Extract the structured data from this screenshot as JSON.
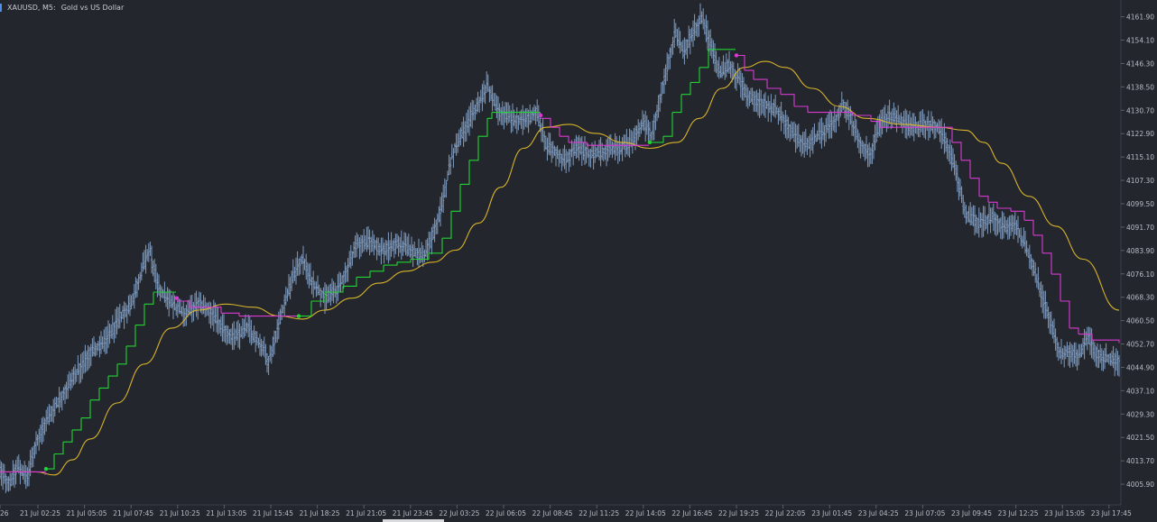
{
  "title": {
    "symbol": "XAUUSD, M5:",
    "description": "Gold vs US Dollar"
  },
  "colors": {
    "background": "#23262d",
    "candles": "#7f9cc0",
    "trend_up": "#22d334",
    "trend_down": "#d93ad2",
    "moving_average": "#d8b32a",
    "axis_text": "#b8bcc4"
  },
  "chart_data": {
    "type": "line",
    "style": "OHLC bars with step trailing line (green up / magenta down) and smooth moving average",
    "grid": false,
    "y_ticks": [
      "4161.90",
      "4154.10",
      "4146.30",
      "4138.50",
      "4130.70",
      "4122.90",
      "4115.10",
      "4107.30",
      "4099.50",
      "4091.70",
      "4083.90",
      "4076.10",
      "4068.30",
      "4060.50",
      "4052.70",
      "4044.90",
      "4037.10",
      "4029.30",
      "4021.50",
      "4013.70",
      "4005.90"
    ],
    "ylim": [
      3999.0,
      4167.5
    ],
    "x_ticks": [
      "26",
      "21 Jul 02:25",
      "21 Jul 05:05",
      "21 Jul 07:45",
      "21 Jul 10:25",
      "21 Jul 13:05",
      "21 Jul 15:45",
      "21 Jul 18:25",
      "21 Jul 21:05",
      "21 Jul 23:45",
      "22 Jul 03:25",
      "22 Jul 06:05",
      "22 Jul 08:45",
      "22 Jul 11:25",
      "22 Jul 14:05",
      "22 Jul 16:45",
      "22 Jul 19:25",
      "22 Jul 22:05",
      "23 Jul 01:45",
      "23 Jul 04:25",
      "23 Jul 07:05",
      "23 Jul 09:45",
      "23 Jul 12:25",
      "23 Jul 15:05",
      "23 Jul 17:45"
    ],
    "price_series": [
      {
        "bar": 0,
        "price": 4010
      },
      {
        "bar": 10,
        "price": 4006
      },
      {
        "bar": 20,
        "price": 4012
      },
      {
        "bar": 30,
        "price": 4008
      },
      {
        "bar": 40,
        "price": 4020
      },
      {
        "bar": 55,
        "price": 4029
      },
      {
        "bar": 70,
        "price": 4036
      },
      {
        "bar": 85,
        "price": 4043
      },
      {
        "bar": 100,
        "price": 4050
      },
      {
        "bar": 115,
        "price": 4053
      },
      {
        "bar": 130,
        "price": 4060
      },
      {
        "bar": 145,
        "price": 4066
      },
      {
        "bar": 158,
        "price": 4078
      },
      {
        "bar": 166,
        "price": 4084
      },
      {
        "bar": 175,
        "price": 4071
      },
      {
        "bar": 190,
        "price": 4066
      },
      {
        "bar": 205,
        "price": 4063
      },
      {
        "bar": 220,
        "price": 4066
      },
      {
        "bar": 235,
        "price": 4063
      },
      {
        "bar": 245,
        "price": 4058
      },
      {
        "bar": 260,
        "price": 4055
      },
      {
        "bar": 275,
        "price": 4058
      },
      {
        "bar": 290,
        "price": 4052
      },
      {
        "bar": 298,
        "price": 4047
      },
      {
        "bar": 305,
        "price": 4055
      },
      {
        "bar": 315,
        "price": 4066
      },
      {
        "bar": 325,
        "price": 4076
      },
      {
        "bar": 335,
        "price": 4081
      },
      {
        "bar": 345,
        "price": 4074
      },
      {
        "bar": 360,
        "price": 4068
      },
      {
        "bar": 375,
        "price": 4071
      },
      {
        "bar": 385,
        "price": 4078
      },
      {
        "bar": 395,
        "price": 4086
      },
      {
        "bar": 410,
        "price": 4087
      },
      {
        "bar": 425,
        "price": 4084
      },
      {
        "bar": 440,
        "price": 4086
      },
      {
        "bar": 455,
        "price": 4084
      },
      {
        "bar": 470,
        "price": 4082
      },
      {
        "bar": 480,
        "price": 4089
      },
      {
        "bar": 490,
        "price": 4099
      },
      {
        "bar": 500,
        "price": 4115
      },
      {
        "bar": 510,
        "price": 4122
      },
      {
        "bar": 520,
        "price": 4127
      },
      {
        "bar": 530,
        "price": 4133
      },
      {
        "bar": 540,
        "price": 4139
      },
      {
        "bar": 550,
        "price": 4131
      },
      {
        "bar": 565,
        "price": 4128
      },
      {
        "bar": 580,
        "price": 4127
      },
      {
        "bar": 595,
        "price": 4130
      },
      {
        "bar": 605,
        "price": 4119
      },
      {
        "bar": 615,
        "price": 4117
      },
      {
        "bar": 625,
        "price": 4114
      },
      {
        "bar": 640,
        "price": 4118
      },
      {
        "bar": 655,
        "price": 4116
      },
      {
        "bar": 670,
        "price": 4117
      },
      {
        "bar": 685,
        "price": 4118
      },
      {
        "bar": 700,
        "price": 4120
      },
      {
        "bar": 712,
        "price": 4127
      },
      {
        "bar": 722,
        "price": 4122
      },
      {
        "bar": 730,
        "price": 4133
      },
      {
        "bar": 740,
        "price": 4146
      },
      {
        "bar": 748,
        "price": 4157
      },
      {
        "bar": 758,
        "price": 4150
      },
      {
        "bar": 768,
        "price": 4157
      },
      {
        "bar": 778,
        "price": 4162
      },
      {
        "bar": 788,
        "price": 4152
      },
      {
        "bar": 798,
        "price": 4143
      },
      {
        "bar": 808,
        "price": 4146
      },
      {
        "bar": 818,
        "price": 4141
      },
      {
        "bar": 830,
        "price": 4135
      },
      {
        "bar": 845,
        "price": 4133
      },
      {
        "bar": 860,
        "price": 4131
      },
      {
        "bar": 870,
        "price": 4127
      },
      {
        "bar": 880,
        "price": 4122
      },
      {
        "bar": 895,
        "price": 4119
      },
      {
        "bar": 910,
        "price": 4123
      },
      {
        "bar": 925,
        "price": 4127
      },
      {
        "bar": 935,
        "price": 4133
      },
      {
        "bar": 945,
        "price": 4126
      },
      {
        "bar": 955,
        "price": 4119
      },
      {
        "bar": 965,
        "price": 4116
      },
      {
        "bar": 975,
        "price": 4126
      },
      {
        "bar": 985,
        "price": 4129
      },
      {
        "bar": 1000,
        "price": 4127
      },
      {
        "bar": 1010,
        "price": 4125
      },
      {
        "bar": 1025,
        "price": 4126
      },
      {
        "bar": 1040,
        "price": 4125
      },
      {
        "bar": 1050,
        "price": 4119
      },
      {
        "bar": 1060,
        "price": 4109
      },
      {
        "bar": 1070,
        "price": 4096
      },
      {
        "bar": 1085,
        "price": 4093
      },
      {
        "bar": 1100,
        "price": 4095
      },
      {
        "bar": 1115,
        "price": 4091
      },
      {
        "bar": 1125,
        "price": 4093
      },
      {
        "bar": 1135,
        "price": 4086
      },
      {
        "bar": 1145,
        "price": 4079
      },
      {
        "bar": 1155,
        "price": 4068
      },
      {
        "bar": 1165,
        "price": 4060
      },
      {
        "bar": 1175,
        "price": 4049
      },
      {
        "bar": 1185,
        "price": 4050
      },
      {
        "bar": 1195,
        "price": 4048
      },
      {
        "bar": 1205,
        "price": 4055
      },
      {
        "bar": 1215,
        "price": 4050
      },
      {
        "bar": 1225,
        "price": 4048
      },
      {
        "bar": 1240,
        "price": 4047
      }
    ],
    "trend_line": [
      {
        "bar": 0,
        "price": 4010,
        "dir": "down"
      },
      {
        "bar": 50,
        "price": 4009,
        "dir": "down"
      },
      {
        "bar": 51,
        "price": 4011,
        "dir": "up"
      },
      {
        "bar": 60,
        "price": 4016,
        "dir": "up"
      },
      {
        "bar": 70,
        "price": 4020,
        "dir": "up"
      },
      {
        "bar": 80,
        "price": 4024,
        "dir": "up"
      },
      {
        "bar": 90,
        "price": 4028,
        "dir": "up"
      },
      {
        "bar": 100,
        "price": 4034,
        "dir": "up"
      },
      {
        "bar": 110,
        "price": 4038,
        "dir": "up"
      },
      {
        "bar": 120,
        "price": 4042,
        "dir": "up"
      },
      {
        "bar": 130,
        "price": 4046,
        "dir": "up"
      },
      {
        "bar": 140,
        "price": 4052,
        "dir": "up"
      },
      {
        "bar": 150,
        "price": 4059,
        "dir": "up"
      },
      {
        "bar": 160,
        "price": 4066,
        "dir": "up"
      },
      {
        "bar": 170,
        "price": 4070,
        "dir": "up"
      },
      {
        "bar": 195,
        "price": 4070,
        "dir": "up"
      },
      {
        "bar": 196,
        "price": 4067,
        "dir": "down"
      },
      {
        "bar": 210,
        "price": 4065,
        "dir": "down"
      },
      {
        "bar": 235,
        "price": 4065,
        "dir": "down"
      },
      {
        "bar": 245,
        "price": 4063,
        "dir": "down"
      },
      {
        "bar": 265,
        "price": 4062,
        "dir": "down"
      },
      {
        "bar": 330,
        "price": 4062,
        "dir": "down"
      },
      {
        "bar": 331,
        "price": 4062,
        "dir": "up"
      },
      {
        "bar": 345,
        "price": 4067,
        "dir": "up"
      },
      {
        "bar": 360,
        "price": 4070,
        "dir": "up"
      },
      {
        "bar": 380,
        "price": 4072,
        "dir": "up"
      },
      {
        "bar": 395,
        "price": 4075,
        "dir": "up"
      },
      {
        "bar": 410,
        "price": 4077,
        "dir": "up"
      },
      {
        "bar": 425,
        "price": 4079,
        "dir": "up"
      },
      {
        "bar": 440,
        "price": 4080,
        "dir": "up"
      },
      {
        "bar": 455,
        "price": 4081,
        "dir": "up"
      },
      {
        "bar": 475,
        "price": 4083,
        "dir": "up"
      },
      {
        "bar": 490,
        "price": 4088,
        "dir": "up"
      },
      {
        "bar": 500,
        "price": 4097,
        "dir": "up"
      },
      {
        "bar": 510,
        "price": 4106,
        "dir": "up"
      },
      {
        "bar": 520,
        "price": 4114,
        "dir": "up"
      },
      {
        "bar": 530,
        "price": 4122,
        "dir": "up"
      },
      {
        "bar": 540,
        "price": 4128,
        "dir": "up"
      },
      {
        "bar": 545,
        "price": 4130,
        "dir": "up"
      },
      {
        "bar": 598,
        "price": 4130,
        "dir": "up"
      },
      {
        "bar": 599,
        "price": 4128,
        "dir": "down"
      },
      {
        "bar": 610,
        "price": 4125,
        "dir": "down"
      },
      {
        "bar": 620,
        "price": 4122,
        "dir": "down"
      },
      {
        "bar": 630,
        "price": 4120,
        "dir": "down"
      },
      {
        "bar": 650,
        "price": 4119,
        "dir": "down"
      },
      {
        "bar": 719,
        "price": 4119,
        "dir": "down"
      },
      {
        "bar": 720,
        "price": 4120,
        "dir": "up"
      },
      {
        "bar": 735,
        "price": 4122,
        "dir": "up"
      },
      {
        "bar": 745,
        "price": 4130,
        "dir": "up"
      },
      {
        "bar": 755,
        "price": 4136,
        "dir": "up"
      },
      {
        "bar": 765,
        "price": 4140,
        "dir": "up"
      },
      {
        "bar": 775,
        "price": 4145,
        "dir": "up"
      },
      {
        "bar": 785,
        "price": 4151,
        "dir": "up"
      },
      {
        "bar": 815,
        "price": 4151,
        "dir": "up"
      },
      {
        "bar": 816,
        "price": 4149,
        "dir": "down"
      },
      {
        "bar": 825,
        "price": 4144,
        "dir": "down"
      },
      {
        "bar": 835,
        "price": 4141,
        "dir": "down"
      },
      {
        "bar": 850,
        "price": 4138,
        "dir": "down"
      },
      {
        "bar": 865,
        "price": 4136,
        "dir": "down"
      },
      {
        "bar": 880,
        "price": 4132,
        "dir": "down"
      },
      {
        "bar": 895,
        "price": 4130,
        "dir": "down"
      },
      {
        "bar": 930,
        "price": 4130,
        "dir": "down"
      },
      {
        "bar": 945,
        "price": 4129,
        "dir": "down"
      },
      {
        "bar": 965,
        "price": 4127,
        "dir": "down"
      },
      {
        "bar": 975,
        "price": 4125,
        "dir": "down"
      },
      {
        "bar": 1045,
        "price": 4125,
        "dir": "down"
      },
      {
        "bar": 1055,
        "price": 4120,
        "dir": "down"
      },
      {
        "bar": 1065,
        "price": 4114,
        "dir": "down"
      },
      {
        "bar": 1075,
        "price": 4108,
        "dir": "down"
      },
      {
        "bar": 1085,
        "price": 4102,
        "dir": "down"
      },
      {
        "bar": 1095,
        "price": 4100,
        "dir": "down"
      },
      {
        "bar": 1105,
        "price": 4098,
        "dir": "down"
      },
      {
        "bar": 1120,
        "price": 4097,
        "dir": "down"
      },
      {
        "bar": 1135,
        "price": 4094,
        "dir": "down"
      },
      {
        "bar": 1145,
        "price": 4089,
        "dir": "down"
      },
      {
        "bar": 1155,
        "price": 4083,
        "dir": "down"
      },
      {
        "bar": 1165,
        "price": 4076,
        "dir": "down"
      },
      {
        "bar": 1175,
        "price": 4067,
        "dir": "down"
      },
      {
        "bar": 1185,
        "price": 4058,
        "dir": "down"
      },
      {
        "bar": 1195,
        "price": 4056,
        "dir": "down"
      },
      {
        "bar": 1210,
        "price": 4054,
        "dir": "down"
      },
      {
        "bar": 1240,
        "price": 4053,
        "dir": "down"
      }
    ],
    "trend_signals": [
      {
        "bar": 51,
        "price": 4011,
        "dir": "up"
      },
      {
        "bar": 196,
        "price": 4068,
        "dir": "down"
      },
      {
        "bar": 331,
        "price": 4062,
        "dir": "up"
      },
      {
        "bar": 599,
        "price": 4129,
        "dir": "down"
      },
      {
        "bar": 720,
        "price": 4120,
        "dir": "up"
      },
      {
        "bar": 816,
        "price": 4149,
        "dir": "down"
      }
    ],
    "moving_average": [
      {
        "bar": 0,
        "price": 4010
      },
      {
        "bar": 40,
        "price": 4010
      },
      {
        "bar": 60,
        "price": 4009
      },
      {
        "bar": 80,
        "price": 4014
      },
      {
        "bar": 100,
        "price": 4021
      },
      {
        "bar": 130,
        "price": 4033
      },
      {
        "bar": 160,
        "price": 4046
      },
      {
        "bar": 190,
        "price": 4058
      },
      {
        "bar": 220,
        "price": 4064
      },
      {
        "bar": 250,
        "price": 4066
      },
      {
        "bar": 280,
        "price": 4065
      },
      {
        "bar": 310,
        "price": 4062
      },
      {
        "bar": 335,
        "price": 4061
      },
      {
        "bar": 360,
        "price": 4064
      },
      {
        "bar": 390,
        "price": 4068
      },
      {
        "bar": 420,
        "price": 4073
      },
      {
        "bar": 450,
        "price": 4077
      },
      {
        "bar": 480,
        "price": 4080
      },
      {
        "bar": 505,
        "price": 4084
      },
      {
        "bar": 530,
        "price": 4093
      },
      {
        "bar": 555,
        "price": 4105
      },
      {
        "bar": 580,
        "price": 4118
      },
      {
        "bar": 605,
        "price": 4125
      },
      {
        "bar": 630,
        "price": 4126
      },
      {
        "bar": 660,
        "price": 4123
      },
      {
        "bar": 690,
        "price": 4120
      },
      {
        "bar": 720,
        "price": 4118
      },
      {
        "bar": 750,
        "price": 4120
      },
      {
        "bar": 775,
        "price": 4128
      },
      {
        "bar": 800,
        "price": 4138
      },
      {
        "bar": 825,
        "price": 4145
      },
      {
        "bar": 848,
        "price": 4147
      },
      {
        "bar": 870,
        "price": 4145
      },
      {
        "bar": 900,
        "price": 4138
      },
      {
        "bar": 930,
        "price": 4132
      },
      {
        "bar": 960,
        "price": 4128
      },
      {
        "bar": 1000,
        "price": 4126
      },
      {
        "bar": 1040,
        "price": 4125
      },
      {
        "bar": 1070,
        "price": 4124
      },
      {
        "bar": 1090,
        "price": 4120
      },
      {
        "bar": 1110,
        "price": 4113
      },
      {
        "bar": 1140,
        "price": 4102
      },
      {
        "bar": 1170,
        "price": 4092
      },
      {
        "bar": 1200,
        "price": 4081
      },
      {
        "bar": 1240,
        "price": 4064
      }
    ]
  }
}
